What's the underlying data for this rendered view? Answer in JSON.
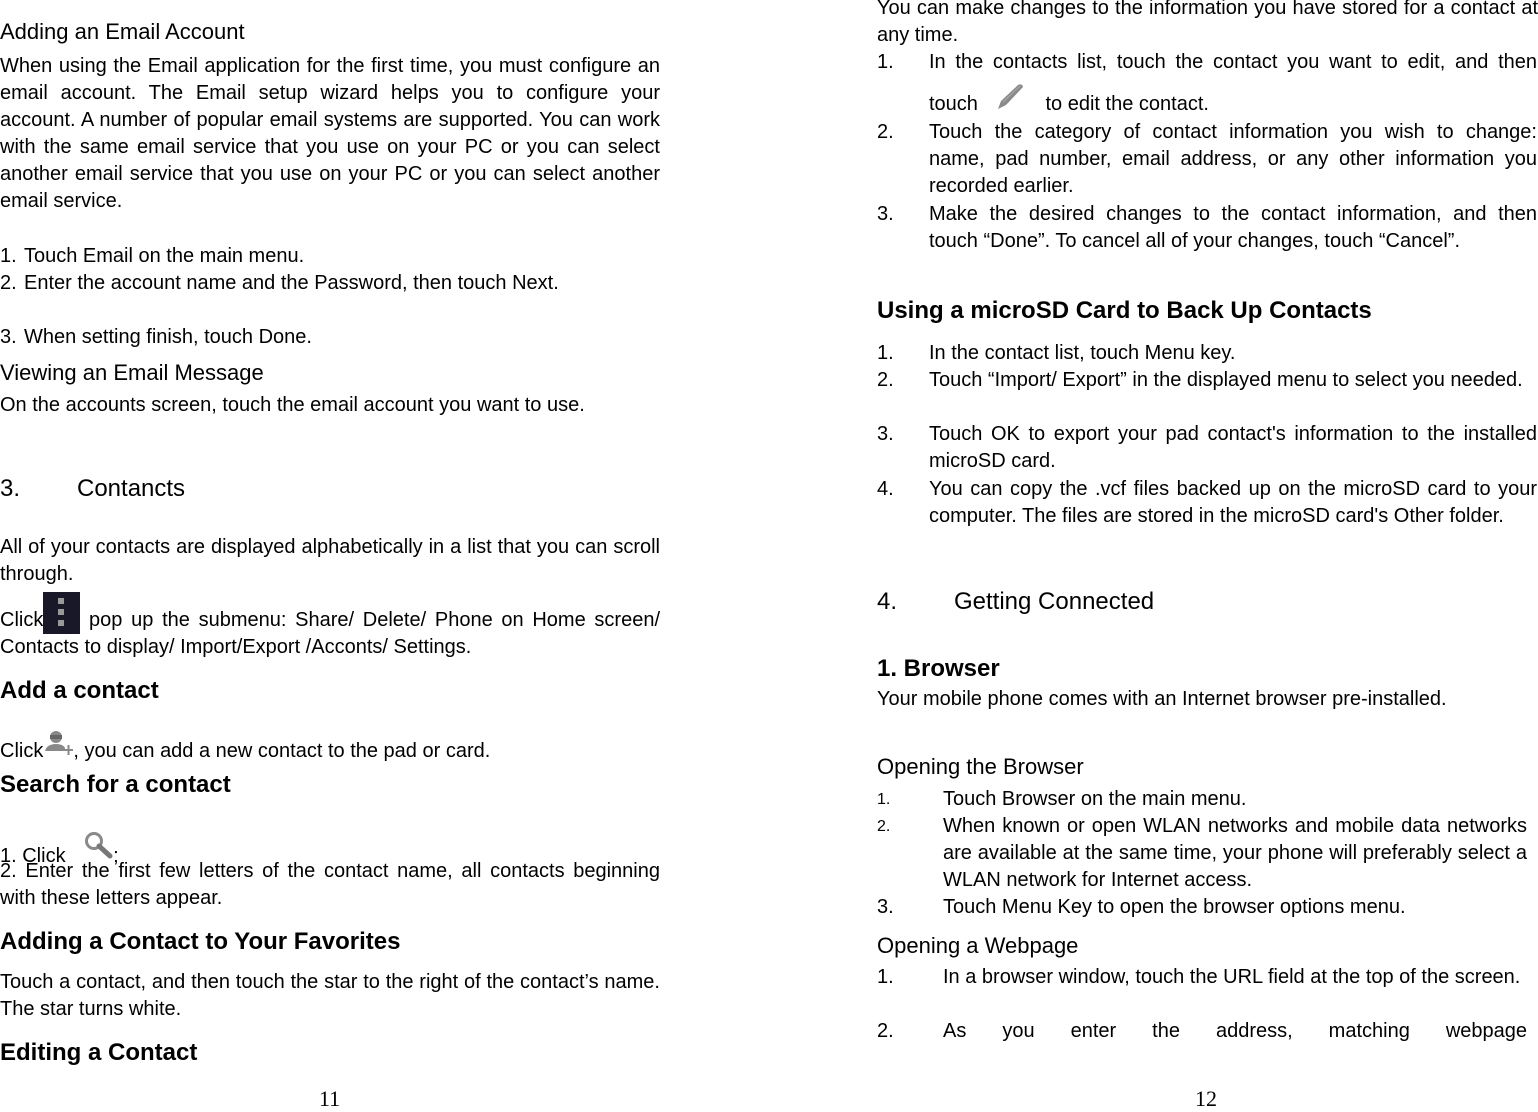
{
  "page11": {
    "email_heading": "Adding an Email Account",
    "email_para": "When using the Email application for the first time, you must configure an email account. The Email setup wizard helps you to configure your account. A number of popular email systems are supported. You can work with the same email service that you use on your PC or you can select another email service that you use on your PC or you can select another email service.",
    "email_steps": [
      {
        "n": "1.",
        "text": "Touch Email on the main menu."
      },
      {
        "n": "2.",
        "text": "Enter the account name and the Password, then touch Next."
      },
      {
        "n": "3.",
        "text": "When setting finish, touch Done."
      }
    ],
    "view_heading": "Viewing an Email Message",
    "view_para": "On the accounts screen, touch the email account you want to use.",
    "section_num": "3.",
    "section_title": "Contancts",
    "contacts_para": "All of your contacts are displayed alphabetically in a list that you can scroll through.",
    "menu_click": "Click",
    "menu_para": " pop up the submenu: Share/ Delete/ Phone on Home screen/ Contacts to display/ Import/Export /Acconts/ Settings.",
    "add_heading": "Add a contact",
    "add_click": "Click",
    "add_para": ", you can add a new contact to the pad or card.",
    "search_heading": "Search for a contact",
    "search_step1": "1. Click",
    "search_step1_end": ";",
    "search_step2": "2. Enter the first few letters of the contact name, all contacts beginning with these letters appear.",
    "fav_heading": "Adding a Contact to Your Favorites",
    "fav_para": "Touch a contact, and then touch the star to the right of the contact’s name. The star turns white.",
    "edit_heading": "Editing a Contact",
    "page_number": "11"
  },
  "page12": {
    "edit_para": "You can make changes to the information you have stored for a contact at any time.",
    "edit_steps": [
      {
        "n": "1.",
        "text": "In the contacts list, touch the contact you want to edit, and then touch",
        "after": " to edit the contact."
      },
      {
        "n": "2.",
        "text": "Touch the category of contact information you wish to change: name, pad number, email address, or any other information you recorded earlier."
      },
      {
        "n": "3.",
        "text": "Make the desired changes to the contact information, and then touch “Done”. To cancel all of your changes, touch “Cancel”."
      }
    ],
    "backup_heading": "Using a microSD Card to Back Up Contacts",
    "backup_steps": [
      {
        "n": "1.",
        "text": "In the contact list, touch Menu key."
      },
      {
        "n": "2.",
        "text": "Touch “Import/ Export” in the displayed menu to select you needed."
      },
      {
        "n": "3.",
        "text": "Touch OK to export your pad contact's information to the installed microSD card."
      },
      {
        "n": "4.",
        "text": "You can copy the .vcf files backed up on the microSD card to your computer. The files are stored in the microSD card's Other folder."
      }
    ],
    "section_num": "4.",
    "section_title": "Getting Connected",
    "browser_heading": "1. Browser",
    "browser_para": "Your mobile phone comes with an Internet browser pre-installed.",
    "open_browser_heading": "Opening the Browser",
    "open_browser_steps": [
      {
        "n": "1.",
        "text": "Touch Browser on the main menu."
      },
      {
        "n": "2.",
        "text": "When known or open WLAN networks and mobile data networks are available at the same time, your phone will preferably select a WLAN network for Internet access."
      },
      {
        "n": "3.",
        "text": "Touch Menu Key to open the browser options menu."
      }
    ],
    "webpage_heading": "Opening a Webpage",
    "webpage_steps": [
      {
        "n": "1.",
        "text": "In a browser window, touch the URL field at the top of the screen."
      },
      {
        "n": "2.",
        "text": "As you enter the address, matching webpage"
      }
    ],
    "page_number": "12"
  },
  "icons": {
    "menu": "overflow-menu-icon",
    "add_contact": "add-contact-icon",
    "search": "search-icon",
    "edit": "pencil-icon"
  },
  "colors": {
    "icon_gray": "#8a8a8a",
    "menu_bg": "#181828"
  }
}
